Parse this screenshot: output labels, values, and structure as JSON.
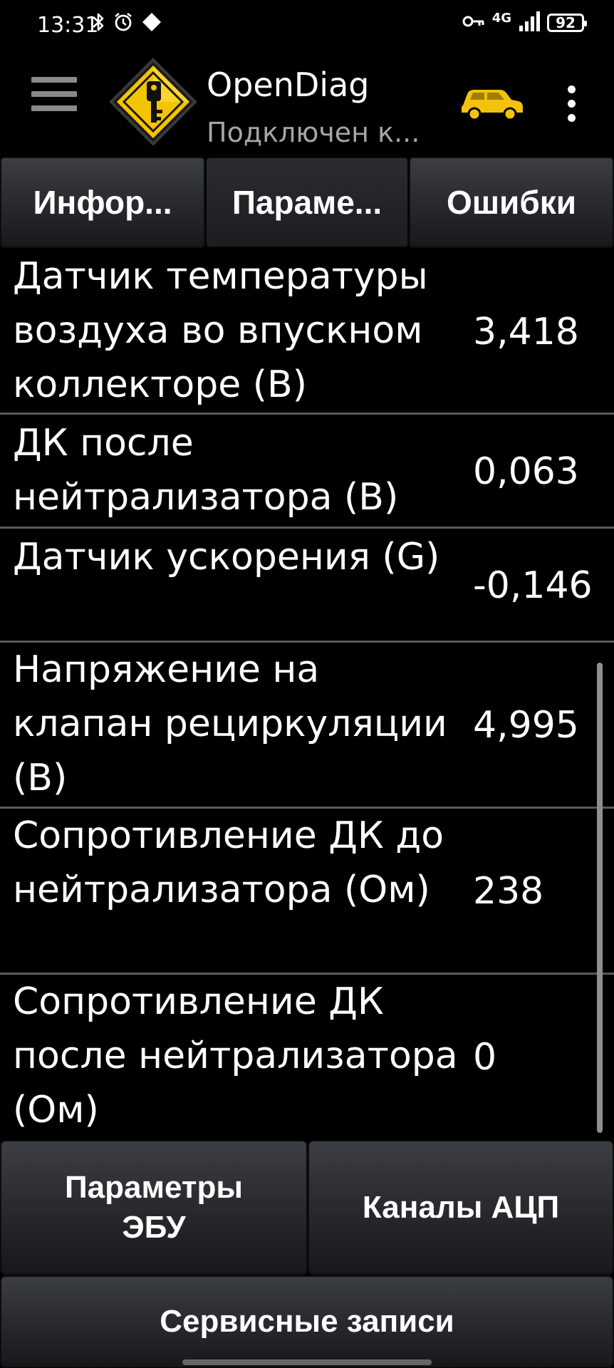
{
  "status_bar": {
    "time": "13:31",
    "left_icons": [
      "bluetooth-icon",
      "alarm-icon",
      "diamond-icon"
    ],
    "right_icons": [
      "vpn-key-icon",
      "network-4g-icon",
      "signal-icon",
      "battery-icon"
    ],
    "network": "4G",
    "battery": "92"
  },
  "app_bar": {
    "title": "OpenDiag",
    "subtitle": "Подключен к...",
    "logo_icon": "key-diamond-logo-icon",
    "car_icon_color": "#f4c20d",
    "menu_icon": "hamburger-menu-icon",
    "overflow_icon": "more-vertical-icon"
  },
  "tabs": [
    {
      "label": "Инфор...",
      "active": false
    },
    {
      "label": "Параме...",
      "active": true
    },
    {
      "label": "Ошибки",
      "active": false
    }
  ],
  "parameters": [
    {
      "name": "Датчик температуры воздуха во впускном коллекторе (В)",
      "value": "3,418"
    },
    {
      "name": "ДК после нейтрализатора (В)",
      "value": "0,063"
    },
    {
      "name": "Датчик ускорения (G)",
      "value": "-0,146"
    },
    {
      "name": "Напряжение на клапан рециркуляции (В)",
      "value": "4,995"
    },
    {
      "name": "Сопротивление ДК до нейтрализатора (Ом)",
      "value": "238"
    },
    {
      "name": "Сопротивление ДК после нейтрализатора (Ом)",
      "value": "0"
    }
  ],
  "bottom_buttons": {
    "ecu_params": "Параметры ЭБУ",
    "adc_channels": "Каналы АЦП",
    "service_records": "Сервисные записи"
  },
  "colors": {
    "background": "#000000",
    "accent_yellow": "#f4c20d",
    "divider": "#5a5a5a",
    "subtitle": "#a6a6a6"
  }
}
